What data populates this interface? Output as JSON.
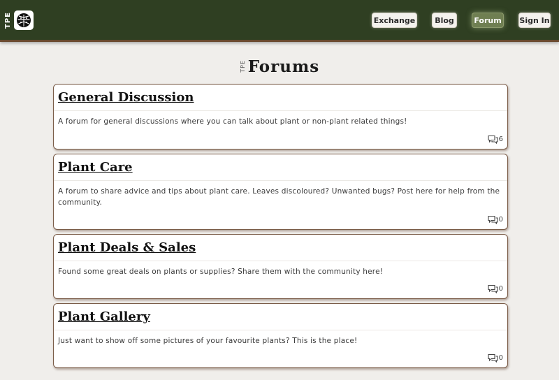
{
  "nav": {
    "brand_text": "TPE",
    "logo_icon": "monstera-leaf-icon",
    "buttons": [
      {
        "label": "Exchange",
        "active": false
      },
      {
        "label": "Blog",
        "active": false
      },
      {
        "label": "Forum",
        "active": true
      },
      {
        "label": "Sign In",
        "active": false
      }
    ],
    "colors": {
      "bar": "#2f3f22",
      "active": "#6f7f52"
    }
  },
  "page": {
    "heading_tag": "TPE",
    "heading_title": "Forums"
  },
  "forums": [
    {
      "title": "General Discussion",
      "description": "A forum for general discussions where you can talk about plant or non-plant related things!",
      "post_count": "6",
      "icon": "comments-icon"
    },
    {
      "title": "Plant Care",
      "description": "A forum to share advice and tips about plant care. Leaves discoloured? Unwanted bugs? Post here for help from the community.",
      "post_count": "0",
      "icon": "comments-icon"
    },
    {
      "title": "Plant Deals & Sales",
      "description": "Found some great deals on plants or supplies? Share them with the community here!",
      "post_count": "0",
      "icon": "comments-icon"
    },
    {
      "title": "Plant Gallery",
      "description": "Just want to show off some pictures of your favourite plants? This is the place!",
      "post_count": "0",
      "icon": "comments-icon"
    }
  ]
}
